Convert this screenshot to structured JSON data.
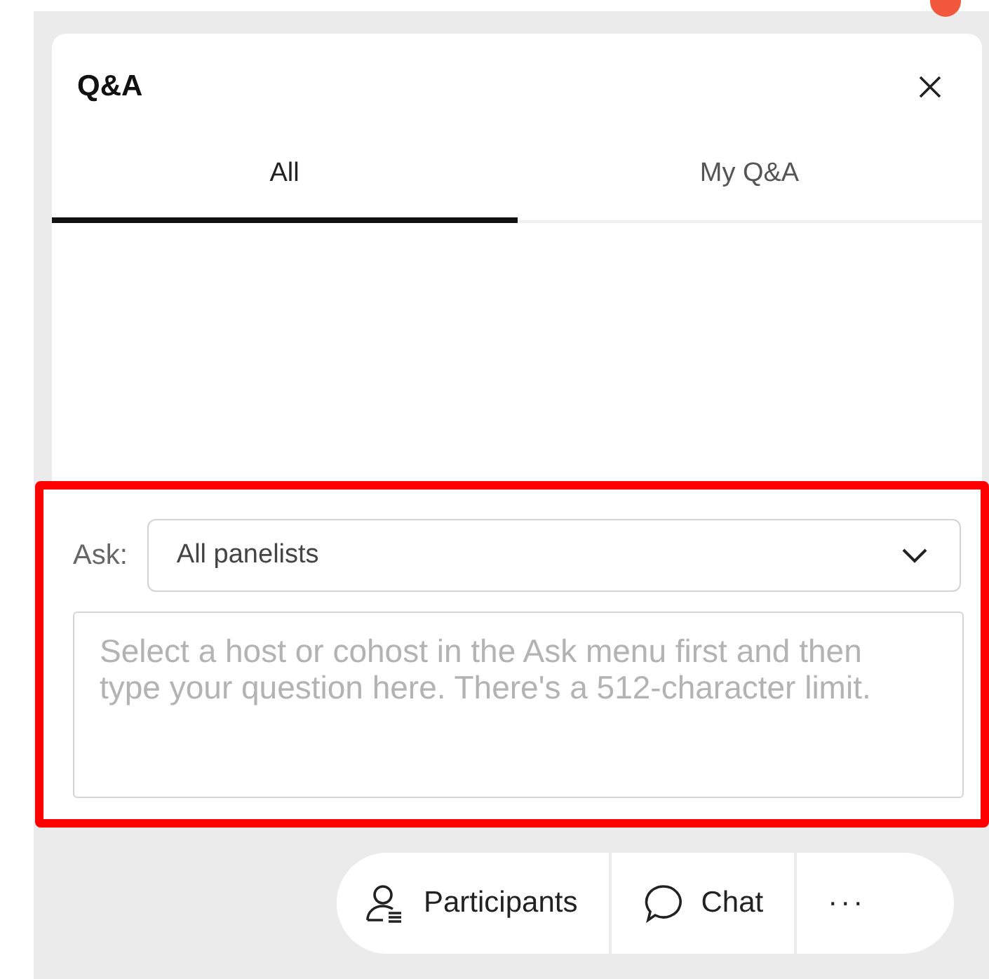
{
  "panel": {
    "title": "Q&A"
  },
  "tabs": [
    {
      "label": "All",
      "selected": true
    },
    {
      "label": "My Q&A",
      "selected": false
    }
  ],
  "ask": {
    "label": "Ask:",
    "recipient": "All panelists"
  },
  "question_field": {
    "placeholder": "Select a host or cohost in the Ask menu first and then type your question here. There's a 512-character limit."
  },
  "toolbar": [
    {
      "kind": "participants",
      "label": "Participants"
    },
    {
      "kind": "chat",
      "label": "Chat"
    },
    {
      "kind": "more",
      "label": "···"
    }
  ]
}
